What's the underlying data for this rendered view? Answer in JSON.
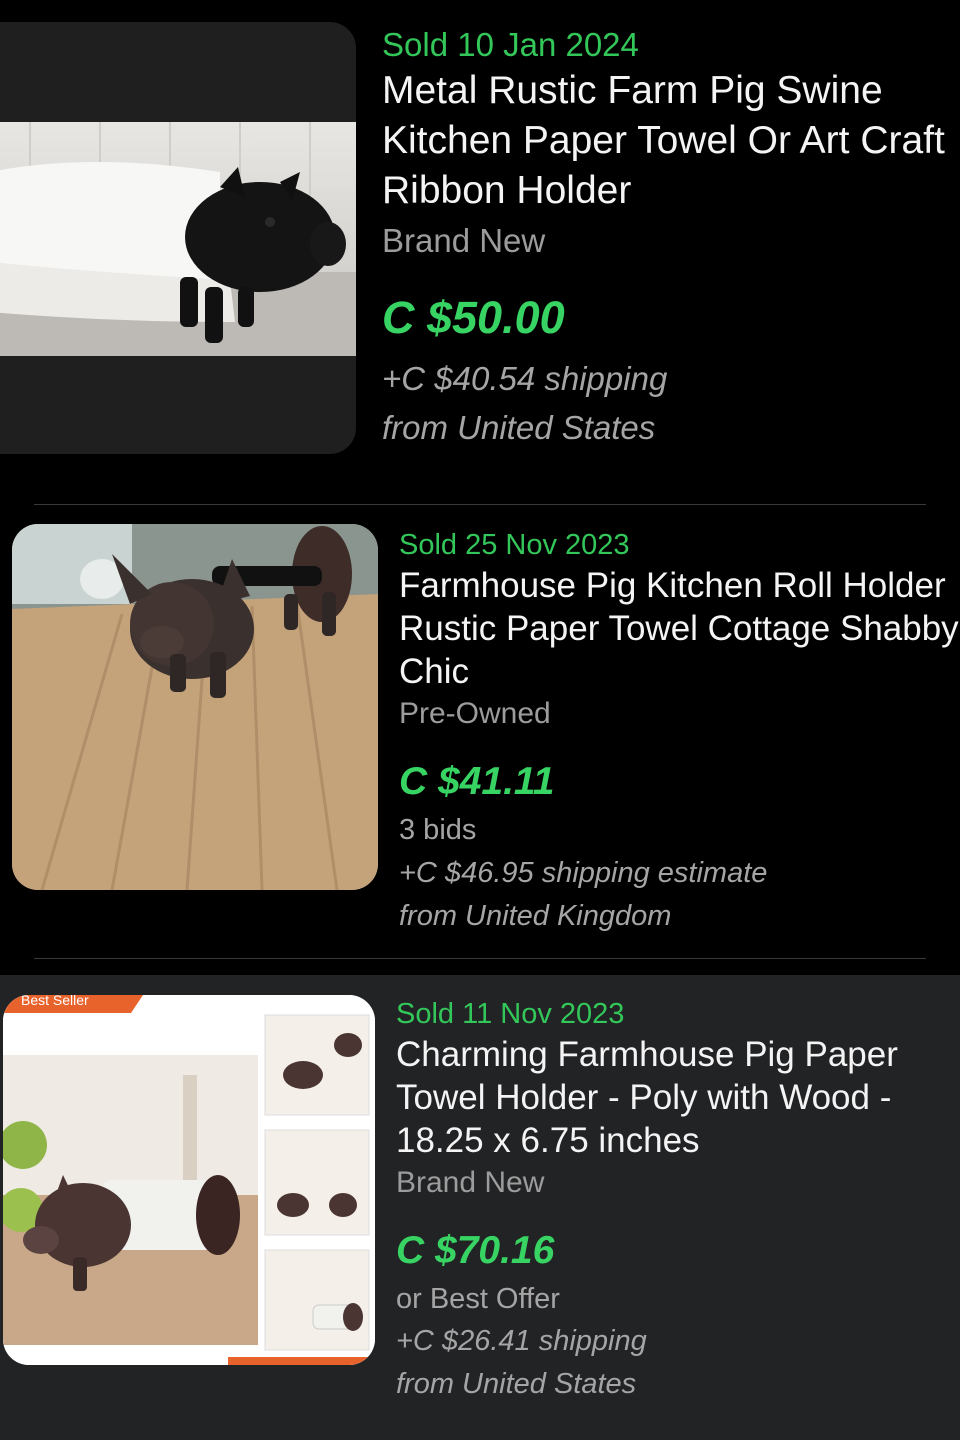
{
  "listings": [
    {
      "sold": "Sold  10 Jan 2024",
      "title": "Metal Rustic Farm Pig Swine Kitchen Paper Towel Or Art Craft Ribbon Holder",
      "condition": "Brand New",
      "price": "C $50.00",
      "shipping": "+C $40.54 shipping",
      "origin": "from United States",
      "image_icon": "pig-paper-towel-holder-photo"
    },
    {
      "sold": "Sold  25 Nov 2023",
      "title": "Farmhouse Pig Kitchen Roll Holder Rustic Paper Towel Cottage Shabby Chic",
      "condition": "Pre-Owned",
      "price": "C $41.11",
      "bids": "3 bids",
      "shipping": "+C $46.95 shipping estimate",
      "origin": "from United Kingdom",
      "image_icon": "pig-kitchen-roll-holder-photo"
    },
    {
      "sold": "Sold  11 Nov 2023",
      "title": "Charming Farmhouse Pig Paper Towel Holder - Poly with Wood - 18.25 x 6.75 inches",
      "condition": "Brand New",
      "price": "C $70.16",
      "offer": "or Best Offer",
      "shipping": "+C $26.41 shipping",
      "origin": "from United States",
      "badge": "Best Seller",
      "image_icon": "pig-towel-holder-product-collage"
    }
  ],
  "colors": {
    "background": "#000000",
    "highlighted_row": "#222325",
    "sold_green": "#33c75a",
    "price_green": "#38d463",
    "secondary_text": "#9c9c9c",
    "badge_orange": "#e8632b"
  }
}
